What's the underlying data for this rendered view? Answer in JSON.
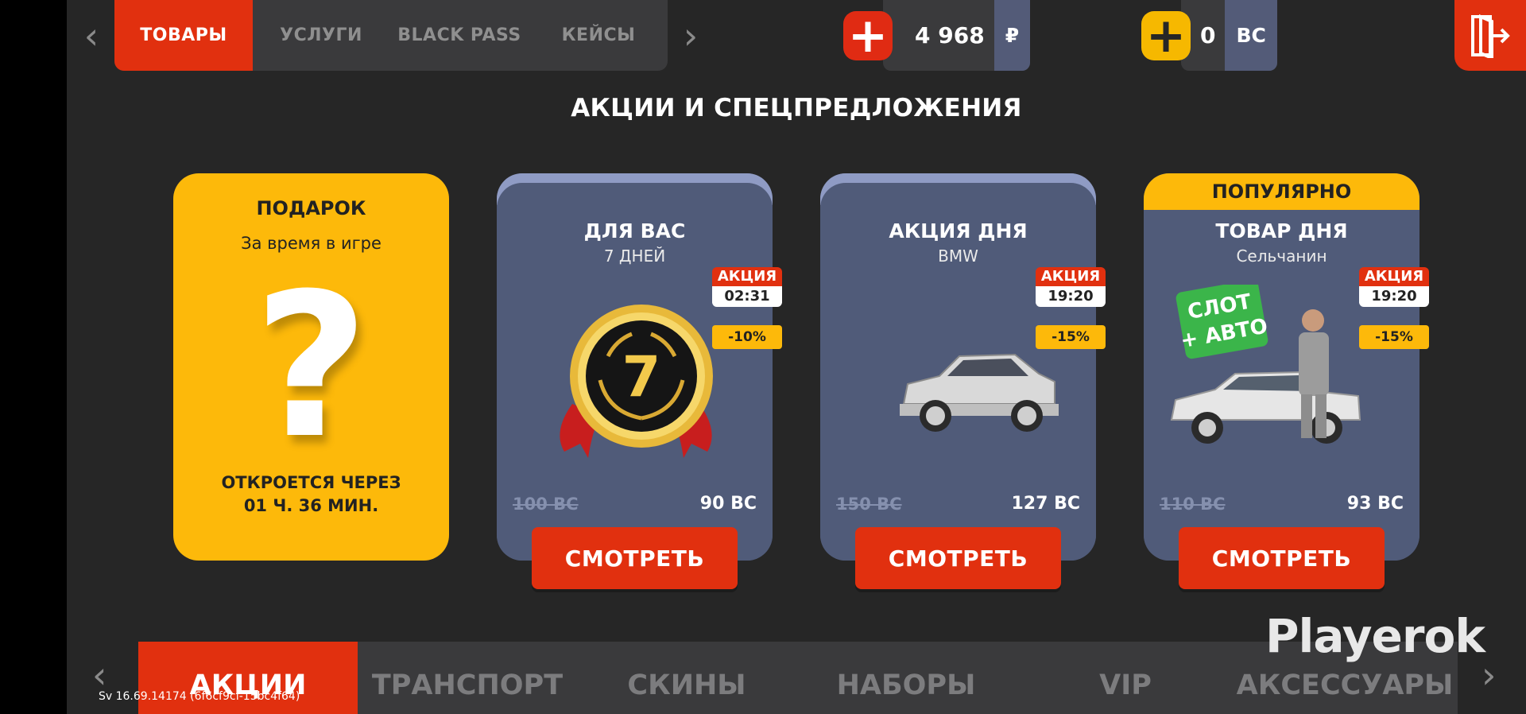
{
  "top_tabs": [
    "ТОВАРЫ",
    "УСЛУГИ",
    "BLACK PASS",
    "КЕЙСЫ"
  ],
  "currency": {
    "rub": {
      "value": "4 968",
      "unit": "₽"
    },
    "bc": {
      "value": "0",
      "unit": "BC"
    }
  },
  "section_title": "АКЦИИ И СПЕЦПРЕДЛОЖЕНИЯ",
  "gift": {
    "title": "ПОДАРОК",
    "subtitle": "За время в игре",
    "symbol": "?",
    "opens_line1": "ОТКРОЕТСЯ ЧЕРЕЗ",
    "opens_line2": "01 Ч. 36 МИН."
  },
  "offers": [
    {
      "title": "ДЛЯ ВАС",
      "subtitle": "7 ДНЕЙ",
      "tag": "АКЦИЯ",
      "timer": "02:31",
      "discount": "-10%",
      "old_price": "100 BC",
      "new_price": "90 BC",
      "button": "СМОТРЕТЬ",
      "badge_number": "7"
    },
    {
      "title": "АКЦИЯ ДНЯ",
      "subtitle": "BMW",
      "tag": "АКЦИЯ",
      "timer": "19:20",
      "discount": "-15%",
      "old_price": "150 BC",
      "new_price": "127 BC",
      "button": "СМОТРЕТЬ"
    },
    {
      "title": "ТОВАР ДНЯ",
      "subtitle": "Сельчанин",
      "tag": "АКЦИЯ",
      "timer": "19:20",
      "discount": "-15%",
      "old_price": "110 BC",
      "new_price": "93 BC",
      "button": "СМОТРЕТЬ",
      "badge": "ПОПУЛЯРНО",
      "sticker_line1": "СЛОТ",
      "sticker_line2": "+ АВТО"
    }
  ],
  "categories": [
    "АКЦИИ",
    "ТРАНСПОРТ",
    "СКИНЫ",
    "НАБОРЫ",
    "VIP",
    "АКСЕССУАРЫ"
  ],
  "version": "Sv 16.69.14174 (6f6cf9cf-15bc4f64)",
  "watermark": "Playerok",
  "colors": {
    "accent_red": "#e1300f",
    "yellow": "#fdb90a",
    "card_blue": "#505b79",
    "background": "#262626"
  }
}
